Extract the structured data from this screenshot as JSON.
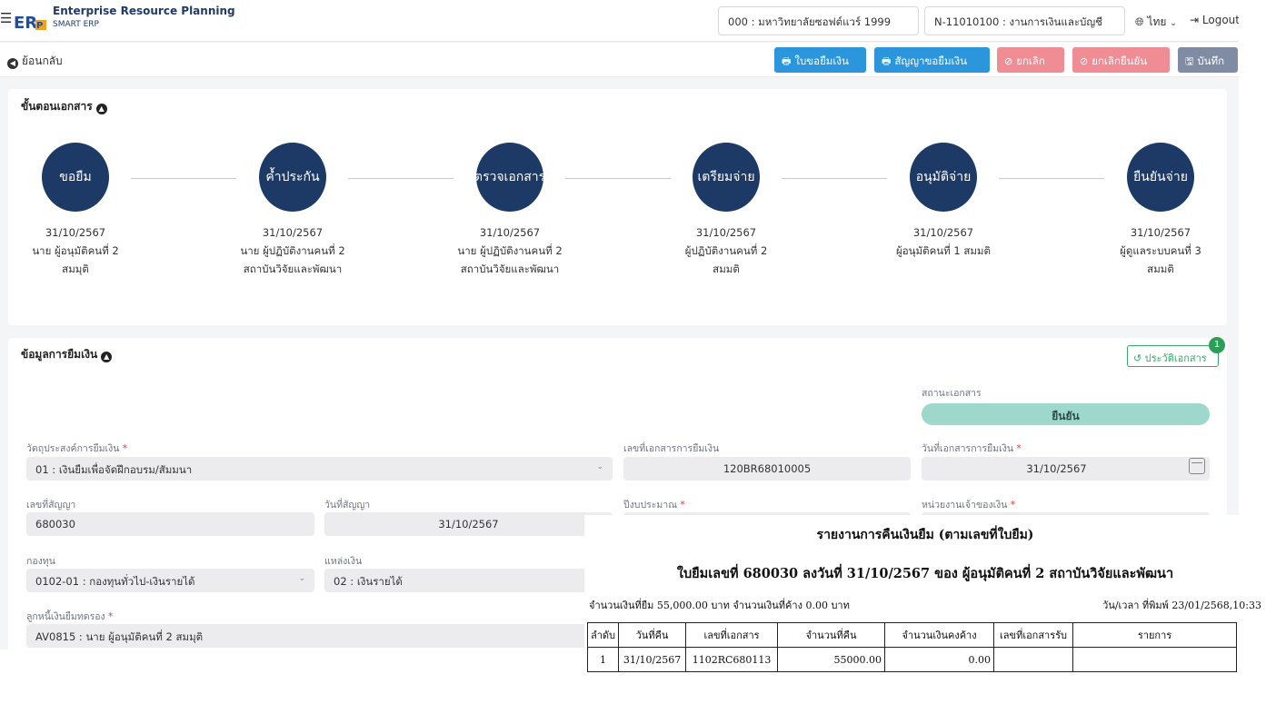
{
  "header": {
    "app_title": "Enterprise Resource Planning",
    "app_subtitle": "SMART ERP",
    "organization": "000 : มหาวิทยาลัยซอฟต์แวร์ 1999",
    "department": "N-11010100 : งานการเงินและบัญชี",
    "language": "ไทย",
    "logout": "Logout"
  },
  "toolbar": {
    "back": "ย้อนกลับ",
    "btn_loan_form": "ใบขอยืมเงิน",
    "btn_loan_contract": "สัญญาขอยืมเงิน",
    "btn_cancel": "ยกเลิก",
    "btn_cancel_confirm": "ยกเลิกยืนยัน",
    "btn_save": "บันทึก"
  },
  "steps_card": {
    "title": "ขั้นตอนเอกสาร",
    "steps": [
      {
        "label": "ขอยืม",
        "date": "31/10/2567",
        "person": "นาย ผู้อนุมัติคนที่ 2",
        "status": "สมมุติ"
      },
      {
        "label": "ค้ำประกัน",
        "date": "31/10/2567",
        "person": "นาย ผู้ปฏิบัติงานคนที่ 2 สถาบันวิจัยและพัฒนา",
        "status": ""
      },
      {
        "label": "ตรวจเอกสาร",
        "date": "31/10/2567",
        "person": "นาย ผู้ปฏิบัติงานคนที่ 2 สถาบันวิจัยและพัฒนา",
        "status": ""
      },
      {
        "label": "เตรียมจ่าย",
        "date": "31/10/2567",
        "person": "ผู้ปฏิบัติงานคนที่ 2",
        "status": "สมมติ"
      },
      {
        "label": "อนุมัติจ่าย",
        "date": "31/10/2567",
        "person": "ผู้อนุมัติคนที่ 1 สมมติ",
        "status": ""
      },
      {
        "label": "ยืนยันจ่าย",
        "date": "31/10/2567",
        "person": "ผู้ดูแลระบบคนที่ 3",
        "status": "สมมติ"
      }
    ]
  },
  "loan_card": {
    "title": "ข้อมูลการยืมเงิน",
    "history_button": "ประวัติเอกสาร",
    "history_count": "1",
    "doc_status_label": "สถานะเอกสาร",
    "doc_status_value": "ยืนยัน",
    "purpose_label": "วัตถุประสงค์การยืมเงิน",
    "purpose_value": "01 : เงินยืมเพื่อจัดฝึกอบรม/สัมมนา",
    "doc_no_label": "เลขที่เอกสารการยืมเงิน",
    "doc_no_value": "120BR68010005",
    "doc_date_label": "วันที่เอกสารการยืมเงิน",
    "doc_date_value": "31/10/2567",
    "contract_no_label": "เลขที่สัญญา",
    "contract_no_value": "680030",
    "contract_date_label": "วันที่สัญญา",
    "contract_date_value": "31/10/2567",
    "budget_year_label": "ปีงบประมาณ",
    "owner_unit_label": "หน่วยงานเจ้าของเงิน",
    "fund_label": "กองทุน",
    "fund_value": "0102-01 : กองทุนทั่วไป-เงินรายได้",
    "source_label": "แหล่งเงิน",
    "source_value": "02 : เงินรายได้",
    "debtor_label": "ลูกหนี้เงินยืมทดรอง",
    "debtor_value": "AV0815 : นาย ผู้อนุมัติคนที่ 2 สมมุติ"
  },
  "report": {
    "title": "รายงานการคืนเงินยืม (ตามเลขที่ใบยืม)",
    "subtitle": "ใบยืมเลขที่ 680030 ลงวันที่ 31/10/2567 ของ ผู้อนุมัติคนที่ 2 สถาบันวิจัยและพัฒนา",
    "amount_line": "จำนวนเงินที่ยืม 55,000.00  บาท จำนวนเงินที่ค้าง 0.00  บาท",
    "printed_line": "วัน/เวลา ที่พิมพ์ 23/01/2568,10:33",
    "columns": [
      "ลำดับ",
      "วันที่คืน",
      "เลขที่เอกสาร",
      "จำนวนที่คืน",
      "จำนวนเงินคงค้าง",
      "เลขที่เอกสารรับ",
      "รายการ"
    ],
    "rows": [
      [
        "1",
        "31/10/2567",
        "1102RC680113",
        "55000.00",
        "0.00",
        "",
        ""
      ]
    ]
  },
  "colors": {
    "primary_blue": "#2c96dd",
    "cancel_red": "#f08d94",
    "save_gray": "#7f8ca3",
    "step_navy": "#1d3966",
    "status_teal": "#9ed8cd",
    "history_green": "#3aa66b"
  }
}
